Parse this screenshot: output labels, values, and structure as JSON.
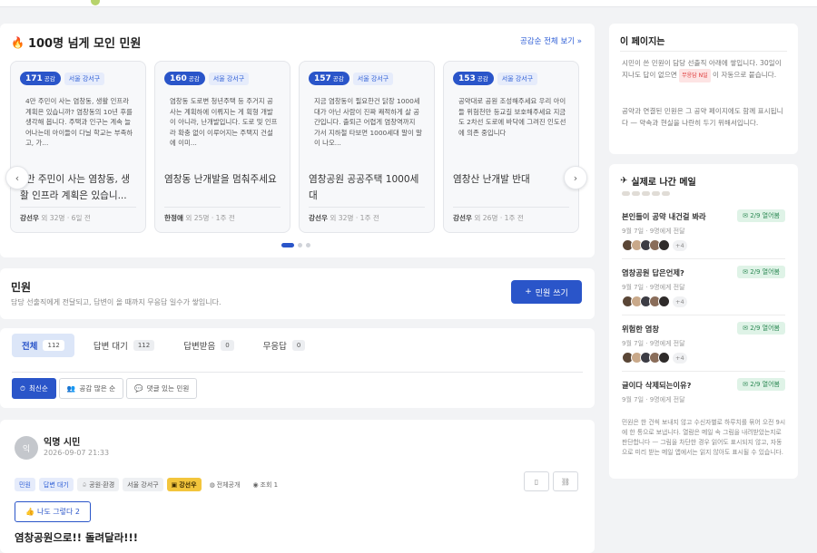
{
  "featured": {
    "title": "100명 넘게 모인 민원",
    "more_link": "공감순 전체 보기 »",
    "cards": [
      {
        "count": "171",
        "count_unit": "공감",
        "region": "서울 강서구",
        "body": "4만 주민이 사는 염창동, 생활 인프라 계획은 있습니까? 염창동의 10년 후를 생각해 봅니다. 주택과 인구는 계속 늘어나는데 아이들이 다닐 학교는 부족하고, 가...",
        "title": "4만 주민이 사는 염창동, 생활 인프라 계획은 있습니...",
        "author": "강선우",
        "meta": "외 32명 · 6일 전"
      },
      {
        "count": "160",
        "count_unit": "공감",
        "region": "서울 강서구",
        "body": "염창동 도로변 청년주택 등 주거지 공사는 계획하에 이뤄지는 게 획형 개발이 아니라, 난개발입니다. 도로 및 인프라 확충 없이 이루어지는 주택지 건설에 이미...",
        "title": "염창동 난개발을 멈춰주세요",
        "author": "한정애",
        "meta": "외 25명 · 1주 전"
      },
      {
        "count": "157",
        "count_unit": "공감",
        "region": "서울 강서구",
        "body": "지금 염창동이 필요한건 닭장 1000세대가 아닌 사람이 진짜 쾌적하게 살 공간입니다. 출퇴근 어렵게 염창역까지 가서 지하철 타보면 1000세대 말이 말이 나오...",
        "title": "염창공원 공공주택 1000세대",
        "author": "강선우",
        "meta": "외 32명 · 1주 전"
      },
      {
        "count": "153",
        "count_unit": "공감",
        "region": "서울 강서구",
        "body": "공약대로 공원 조성해주세요 우리 아이들 위험천만 등교길 보호해주세요 지금도 2차선 도로에 바닥에 그려진 인도선에 의존 중입니다",
        "title": "염창산 난개발 반대",
        "author": "강선우",
        "meta": "외 26명 · 1주 전"
      }
    ]
  },
  "minwon": {
    "title": "민원",
    "description": "담당 선출직에게 전달되고, 답변이 올 때까지 무응답 일수가 쌓입니다.",
    "write_label": "민원 쓰기"
  },
  "tabs": [
    {
      "label": "전체",
      "count": "112"
    },
    {
      "label": "답변 대기",
      "count": "112"
    },
    {
      "label": "답변받음",
      "count": "0"
    },
    {
      "label": "무응답",
      "count": "0"
    }
  ],
  "sorts": [
    "최신순",
    "공감 많은 순",
    "댓글 있는 민원"
  ],
  "post": {
    "avatar_char": "익",
    "author": "익명 시민",
    "date": "2026-09-07 21:33",
    "tags": [
      "민원",
      "답변 대기",
      "공원·환경",
      "서울 강서구",
      "강선우",
      "전체공개",
      "조회 1"
    ],
    "agree_label": "나도 그렇다 2",
    "title": "염창공원으로!! 돌려달라!!!"
  },
  "about": {
    "title": "이 페이지는",
    "p1_a": "시민이 쓴 민원이 담당 선출직 아래에 쌓입니다. 30일이 지나도 답이 없으면",
    "p1_badge": "무응답 N일",
    "p1_b": "이 자동으로 붙습니다.",
    "p2": "공약과 연결된 민원은 그 공약 페이지에도 함께 표시됩니다 — 약속과 현실을 나란히 두기 위해서입니다."
  },
  "mail": {
    "title": "실제로 나간 메일",
    "items": [
      {
        "title": "본인들이 공약 내건걸 봐라",
        "opened": "2/9 열어봄",
        "meta": "9월 7일 · 9명에게 전달",
        "more": "+4",
        "faces": 5
      },
      {
        "title": "염창공원 답은언제?",
        "opened": "2/9 열어봄",
        "meta": "9월 7일 · 9명에게 전달",
        "more": "+4",
        "faces": 5
      },
      {
        "title": "위험한 염창",
        "opened": "2/9 열어봄",
        "meta": "9월 7일 · 9명에게 전달",
        "more": "+4",
        "faces": 5
      },
      {
        "title": "글이다 삭제되는이유?",
        "opened": "2/9 열어봄",
        "meta": "9월 7일 · 9명에게 전달",
        "more": "",
        "faces": 0
      }
    ],
    "note": "민원은 한 건씩 보내지 않고 수신자별로 하루치를 묶어 오전 9시에 한 통으로 보냅니다. 열람은 메일 속 그림을 내려받았는지로 판단합니다 — 그림을 차단한 경우 읽어도 표시되지 않고, 자동으로 미리 받는 메일 앱에서는 읽지 않아도 표시될 수 있습니다."
  },
  "colors": {
    "accent": "#2a55c9",
    "badge_green": "#2e8a55",
    "gold": "#f3c53c"
  }
}
